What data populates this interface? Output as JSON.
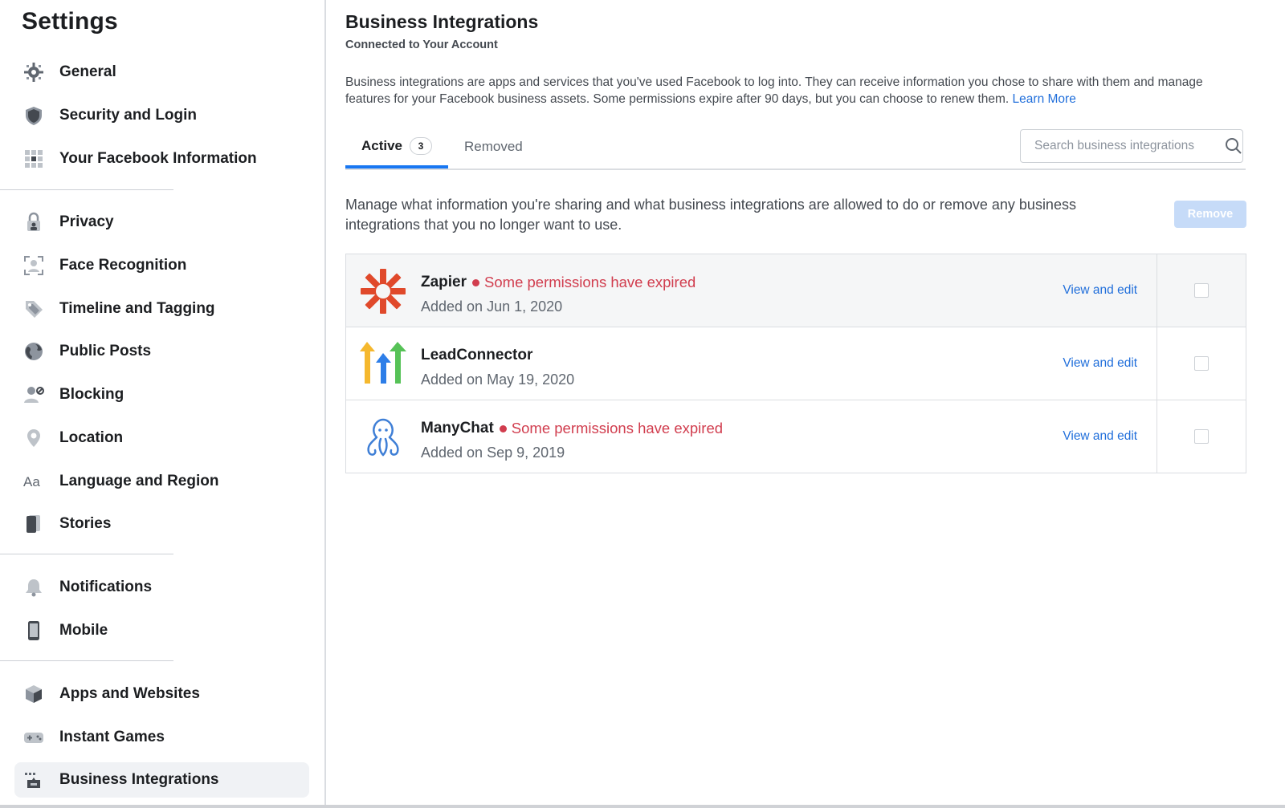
{
  "sidebar": {
    "title": "Settings",
    "groups": [
      {
        "items": [
          {
            "label": "General",
            "icon": "gear-icon"
          },
          {
            "label": "Security and Login",
            "icon": "shield-icon"
          },
          {
            "label": "Your Facebook Information",
            "icon": "facebook-info-icon"
          }
        ]
      },
      {
        "items": [
          {
            "label": "Privacy",
            "icon": "lock-icon"
          },
          {
            "label": "Face Recognition",
            "icon": "face-recognition-icon"
          },
          {
            "label": "Timeline and Tagging",
            "icon": "tag-icon"
          },
          {
            "label": "Public Posts",
            "icon": "globe-icon"
          },
          {
            "label": "Blocking",
            "icon": "block-user-icon"
          },
          {
            "label": "Location",
            "icon": "location-pin-icon"
          },
          {
            "label": "Language and Region",
            "icon": "language-icon"
          },
          {
            "label": "Stories",
            "icon": "stories-icon"
          }
        ]
      },
      {
        "items": [
          {
            "label": "Notifications",
            "icon": "bell-icon"
          },
          {
            "label": "Mobile",
            "icon": "mobile-icon"
          }
        ]
      },
      {
        "items": [
          {
            "label": "Apps and Websites",
            "icon": "cube-icon"
          },
          {
            "label": "Instant Games",
            "icon": "gamepad-icon"
          },
          {
            "label": "Business Integrations",
            "icon": "business-integrations-icon",
            "selected": true
          }
        ]
      }
    ]
  },
  "main": {
    "title": "Business Integrations",
    "subtitle": "Connected to Your Account",
    "description": "Business integrations are apps and services that you've used Facebook to log into. They can receive information you chose to share with them and manage features for your Facebook business assets. Some permissions expire after 90 days, but you can choose to renew them.",
    "learn_more": "Learn More",
    "tabs": {
      "active_label": "Active",
      "active_count": "3",
      "removed_label": "Removed"
    },
    "search": {
      "placeholder": "Search business integrations"
    },
    "manage_text": "Manage what information you're sharing and what business integrations are allowed to do or remove any business integrations that you no longer want to use.",
    "remove_label": "Remove",
    "integrations": [
      {
        "name": "Zapier",
        "status": "Some permissions have expired",
        "added": "Added on Jun 1, 2020",
        "action": "View and edit",
        "logo": "zapier-logo"
      },
      {
        "name": "LeadConnector",
        "status": "",
        "added": "Added on May 19, 2020",
        "action": "View and edit",
        "logo": "leadconnector-logo"
      },
      {
        "name": "ManyChat",
        "status": "Some permissions have expired",
        "added": "Added on Sep 9, 2019",
        "action": "View and edit",
        "logo": "manychat-logo"
      }
    ]
  },
  "colors": {
    "accent": "#1877f2",
    "link": "#216fdb",
    "expired": "#d13d4e",
    "remove_disabled": "#c6dbf8",
    "zapier": "#e0492b",
    "manychat": "#3f7fd6"
  }
}
